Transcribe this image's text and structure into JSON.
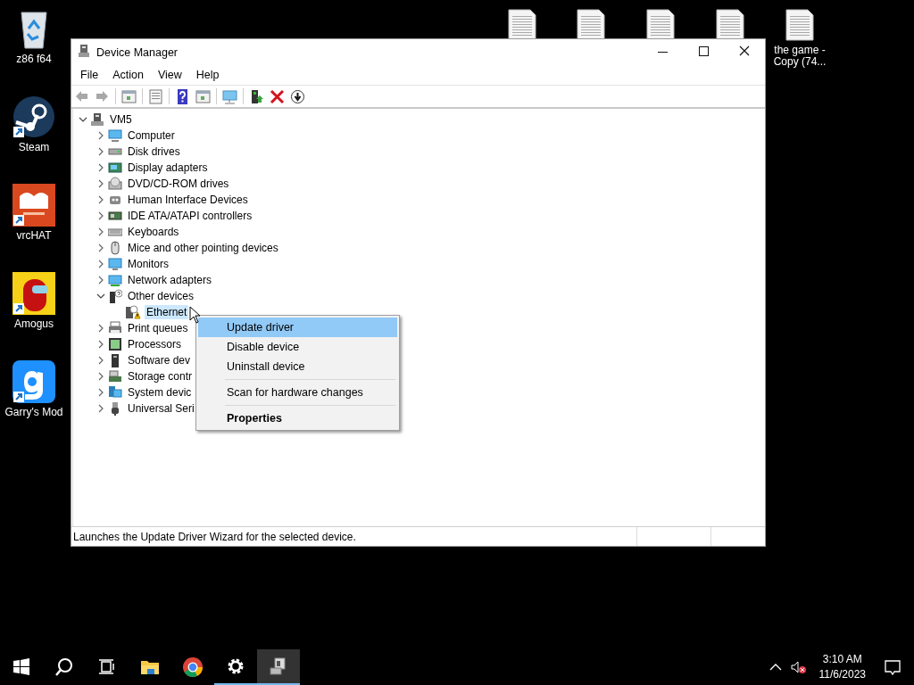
{
  "desktop_icons": [
    {
      "kind": "recycle_bin",
      "label": "z86 f64"
    },
    {
      "kind": "shortcut",
      "label": "Steam"
    },
    {
      "kind": "shortcut",
      "label": "vrcHAT"
    },
    {
      "kind": "shortcut",
      "label": "Amogus"
    },
    {
      "kind": "shortcut",
      "label": "Garry's Mod"
    },
    {
      "kind": "document"
    },
    {
      "kind": "document"
    },
    {
      "kind": "document"
    },
    {
      "kind": "document"
    },
    {
      "kind": "document",
      "label": "the game - Copy (74..."
    }
  ],
  "window": {
    "title": "Device Manager"
  },
  "menu_bar": [
    "File",
    "Action",
    "View",
    "Help"
  ],
  "toolbar": [
    {
      "kind": "back",
      "disabled": true
    },
    {
      "kind": "forward",
      "disabled": true
    },
    {
      "kind": "separator"
    },
    {
      "kind": "panel"
    },
    {
      "kind": "separator"
    },
    {
      "kind": "properties"
    },
    {
      "kind": "separator"
    },
    {
      "kind": "help"
    },
    {
      "kind": "panel"
    },
    {
      "kind": "separator"
    },
    {
      "kind": "monitor"
    },
    {
      "kind": "separator"
    },
    {
      "kind": "update"
    },
    {
      "kind": "remove"
    },
    {
      "kind": "download"
    }
  ],
  "tree": {
    "label": "VM5",
    "expanded": true,
    "selected": false,
    "children": [
      {
        "label": "Computer",
        "expanded": false,
        "selected": false
      },
      {
        "label": "Disk drives",
        "expanded": false,
        "selected": false
      },
      {
        "label": "Display adapters",
        "expanded": false,
        "selected": false
      },
      {
        "label": "DVD/CD-ROM drives",
        "expanded": false,
        "selected": false
      },
      {
        "label": "Human Interface Devices",
        "expanded": false,
        "selected": false
      },
      {
        "label": "IDE ATA/ATAPI controllers",
        "expanded": false,
        "selected": false
      },
      {
        "label": "Keyboards",
        "expanded": false,
        "selected": false
      },
      {
        "label": "Mice and other pointing devices",
        "expanded": false,
        "selected": false
      },
      {
        "label": "Monitors",
        "expanded": false,
        "selected": false
      },
      {
        "label": "Network adapters",
        "expanded": false,
        "selected": false
      },
      {
        "label": "Other devices",
        "expanded": true,
        "selected": false,
        "children": [
          {
            "label": "Ethernet",
            "selected": true
          }
        ]
      },
      {
        "label": "Print queues",
        "expanded": false,
        "selected": false
      },
      {
        "label": "Processors",
        "expanded": false,
        "selected": false
      },
      {
        "label": "Software dev",
        "expanded": false,
        "selected": false
      },
      {
        "label": "Storage contr",
        "expanded": false,
        "selected": false
      },
      {
        "label": "System devic",
        "expanded": false,
        "selected": false
      },
      {
        "label": "Universal Seri",
        "expanded": false,
        "selected": false
      }
    ]
  },
  "context_menu": [
    {
      "kind": "item",
      "label": "Update driver",
      "selected": true
    },
    {
      "kind": "item",
      "label": "Disable device",
      "selected": false
    },
    {
      "kind": "item",
      "label": "Uninstall device",
      "selected": false
    },
    {
      "kind": "separator"
    },
    {
      "kind": "item",
      "label": "Scan for hardware changes",
      "selected": false
    },
    {
      "kind": "separator"
    },
    {
      "kind": "item",
      "label": "Properties",
      "selected": false,
      "default": true
    }
  ],
  "status_bar": {
    "text": "Launches the Update Driver Wizard for the selected device."
  },
  "taskbar": {
    "apps": [
      {
        "kind": "start"
      },
      {
        "kind": "search"
      },
      {
        "kind": "task_view"
      },
      {
        "kind": "explorer",
        "open": false,
        "active": false
      },
      {
        "kind": "chrome",
        "open": false,
        "active": false
      },
      {
        "kind": "settings",
        "open": true,
        "active": false
      },
      {
        "kind": "device_manager",
        "open": true,
        "active": true
      }
    ],
    "time": "3:10 AM",
    "date": "11/6/2023"
  }
}
